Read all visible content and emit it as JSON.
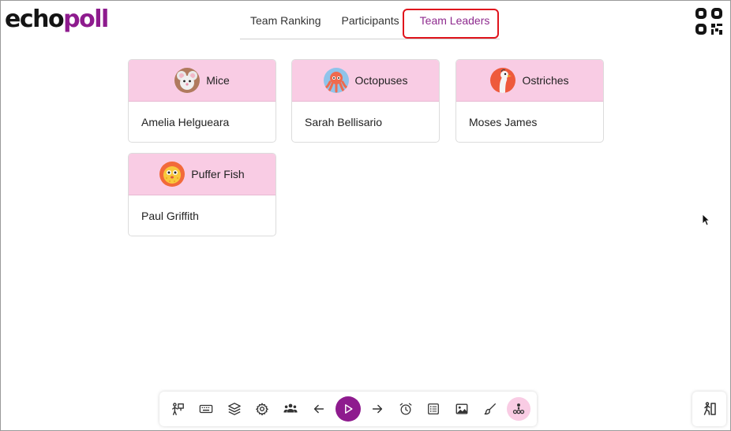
{
  "logo": {
    "part1": "echo",
    "part2": "poll"
  },
  "tabs": [
    {
      "label": "Team Ranking",
      "active": false
    },
    {
      "label": "Participants",
      "active": false
    },
    {
      "label": "Team Leaders",
      "active": true
    }
  ],
  "teams": [
    {
      "name": "Mice",
      "leader": "Amelia Helgueara",
      "avatar": "mouse-icon"
    },
    {
      "name": "Octopuses",
      "leader": "Sarah Bellisario",
      "avatar": "octopus-icon"
    },
    {
      "name": "Ostriches",
      "leader": "Moses James",
      "avatar": "ostrich-icon"
    },
    {
      "name": "Puffer Fish",
      "leader": "Paul Griffith",
      "avatar": "puffer-fish-icon"
    }
  ],
  "toolbar": {
    "buttons": [
      "presenter-icon",
      "keyboard-icon",
      "layers-icon",
      "settings-icon",
      "participants-icon",
      "arrow-left-icon",
      "play-icon",
      "arrow-right-icon",
      "alarm-icon",
      "list-icon",
      "image-icon",
      "brush-icon",
      "ranking-icon"
    ],
    "active": "ranking-icon"
  },
  "colors": {
    "brand": "#8e1b8e",
    "card_header": "#f9cce4",
    "highlight": "#e0141c"
  }
}
